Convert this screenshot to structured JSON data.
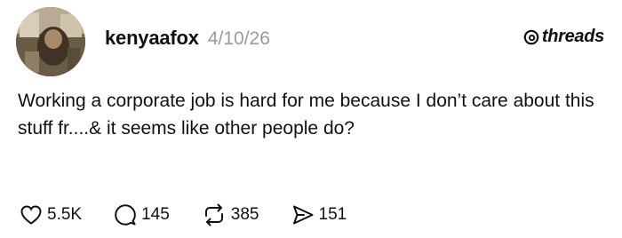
{
  "post": {
    "username": "kenyaafox",
    "date": "4/10/26",
    "brand": "threads",
    "text": "Working a corporate job is hard for me because I don’t care about this stuff fr....& it seems like other people do?",
    "avatar_icon": "avatar-photo",
    "actions": [
      {
        "icon": "heart-icon",
        "count": "5.5K"
      },
      {
        "icon": "comment-icon",
        "count": "145"
      },
      {
        "icon": "repost-icon",
        "count": "385"
      },
      {
        "icon": "send-icon",
        "count": "151"
      }
    ]
  }
}
